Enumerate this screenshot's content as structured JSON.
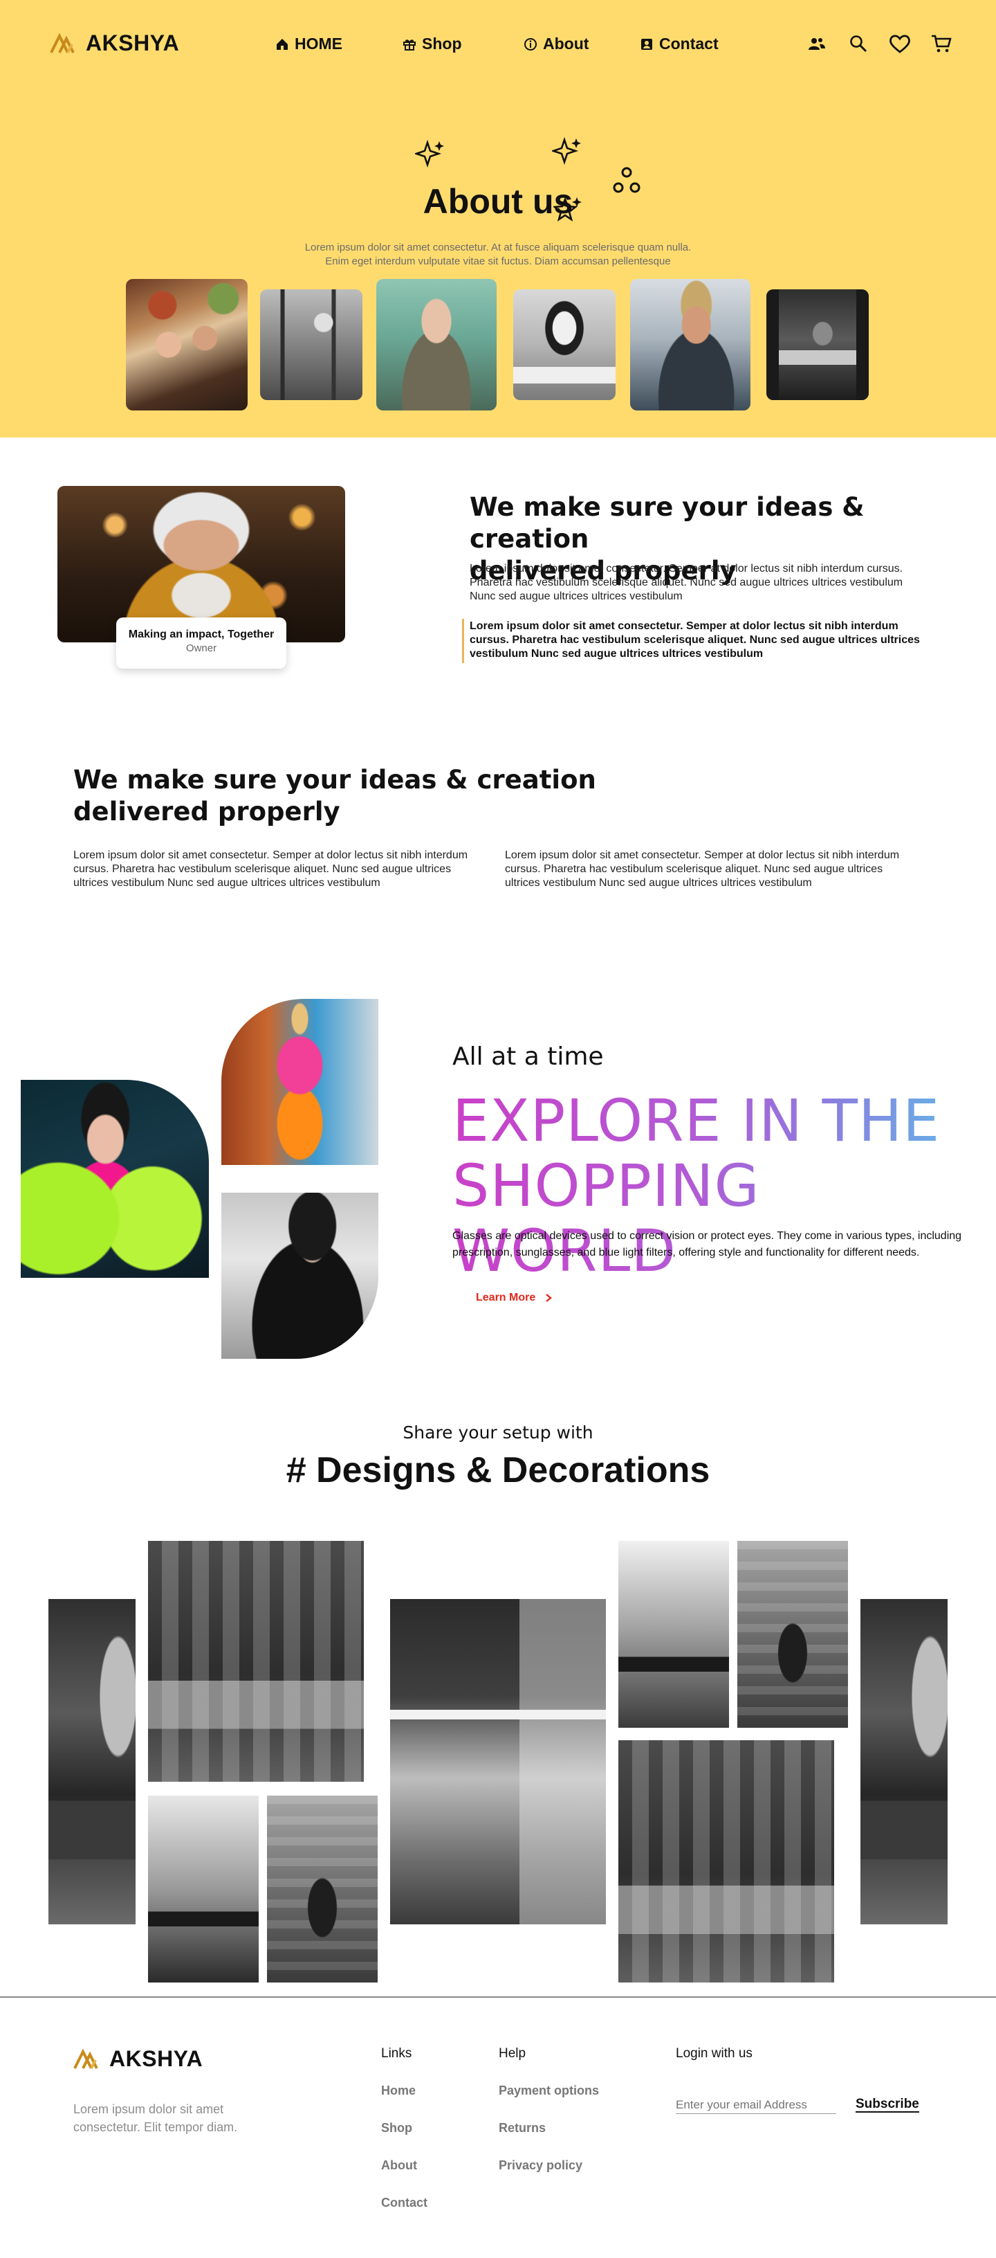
{
  "brand": {
    "name": "AKSHYA"
  },
  "nav": [
    {
      "label": "HOME",
      "icon": "home-icon"
    },
    {
      "label": "Shop",
      "icon": "gift-icon"
    },
    {
      "label": "About",
      "icon": "info-icon"
    },
    {
      "label": "Contact",
      "icon": "contact-card-icon"
    }
  ],
  "header_icons": [
    "users-icon",
    "search-icon",
    "heart-icon",
    "cart-icon"
  ],
  "colors": {
    "hero_bg": "#ffdb6e",
    "accent_red": "#e0291d",
    "logo_gold": "#c98a1b"
  },
  "hero": {
    "title": "About us",
    "lead_1": "Lorem ipsum dolor sit amet consectetur. At at fusce aliquam scelerisque quam nulla.",
    "lead_2": "Enim eget interdum vulputate  vitae sit fuctus. Diam accumsan pellentesque"
  },
  "impact": {
    "card_title": "Making an impact, Together",
    "card_subtitle": "Owner",
    "heading_1": "We make sure your ideas & creation",
    "heading_2": "delivered properly",
    "para_1": "Lorem ipsum dolor sit amet consectetur. Semper at dolor lectus sit nibh interdum cursus. Pharetra hac vestibulum scelerisque aliquet. Nunc sed augue ultrices ultrices vestibulum  Nunc sed augue ultrices ultrices vestibulum",
    "quote": "Lorem ipsum dolor sit amet consectetur. Semper at dolor lectus sit nibh interdum cursus. Pharetra hac vestibulum scelerisque aliquet. Nunc sed augue ultrices ultrices vestibulum  Nunc sed augue ultrices ultrices vestibulum"
  },
  "ideas": {
    "heading_1": "We make sure your ideas & creation",
    "heading_2": "delivered properly",
    "col_1": "Lorem ipsum dolor sit amet consectetur. Semper at dolor lectus sit nibh interdum cursus. Pharetra hac vestibulum scelerisque aliquet. Nunc sed augue ultrices ultrices vestibulum  Nunc sed augue ultrices ultrices vestibulum",
    "col_2": "Lorem ipsum dolor sit amet consectetur. Semper at dolor lectus sit nibh interdum cursus. Pharetra hac vestibulum scelerisque aliquet. Nunc sed augue ultrices ultrices vestibulum  Nunc sed augue ultrices ultrices vestibulum"
  },
  "explore": {
    "kicker": "All at a time",
    "line_1": "EXPLORE IN THE",
    "line_2": "SHOPPING WORLD",
    "body": "Glasses are optical devices used to correct vision or protect eyes. They come in various types, including prescription, sunglasses, and blue light filters, offering style and functionality for different needs.",
    "cta": "Learn More"
  },
  "designs": {
    "kicker": "Share your setup with",
    "title": "# Designs & Decorations"
  },
  "footer": {
    "tagline_1": "Lorem ipsum dolor sit amet",
    "tagline_2": "consectetur. Elit tempor diam.",
    "links_title": "Links",
    "links": [
      "Home",
      "Shop",
      "About",
      "Contact"
    ],
    "help_title": "Help",
    "help": [
      "Payment options",
      "Returns",
      "Privacy policy"
    ],
    "login_title": "Login with us",
    "email_placeholder": "Enter your email Address",
    "subscribe": "Subscribe"
  }
}
